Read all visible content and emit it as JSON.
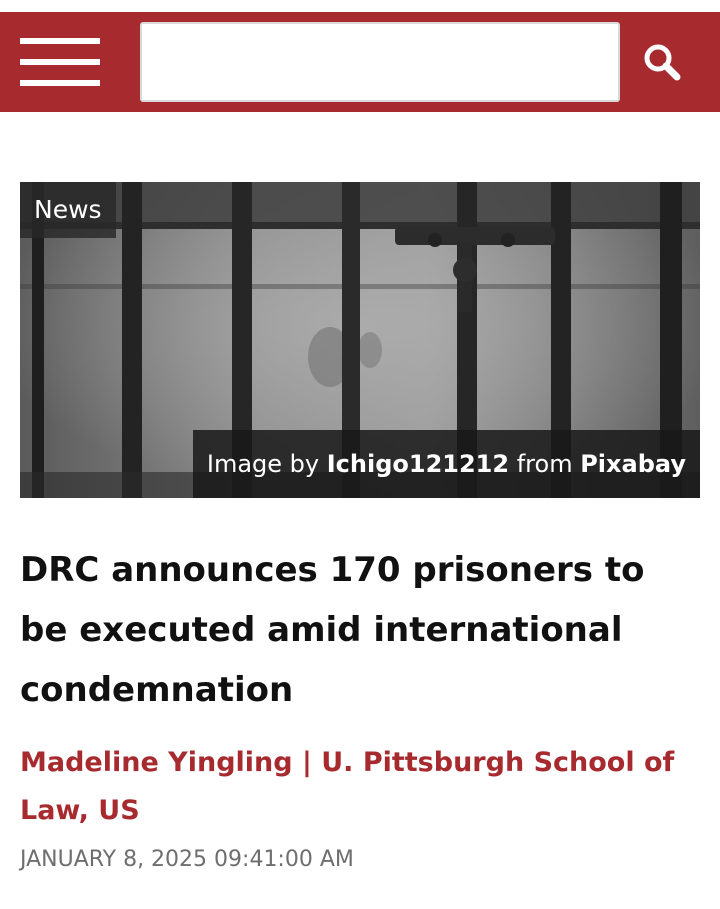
{
  "header": {
    "brand_color": "#a62a2e",
    "menu_icon": "hamburger-menu-icon",
    "search": {
      "value": "",
      "placeholder": ""
    },
    "search_icon": "search-icon"
  },
  "article": {
    "category": "News",
    "image": {
      "description_icon": "prison-bars-photo",
      "credit": {
        "prefix": "Image by",
        "author": "Ichigo121212",
        "middle": "from",
        "source": "Pixabay"
      }
    },
    "headline": "DRC announces 170 prisoners to be executed amid international condemnation",
    "byline": "Madeline Yingling | U. Pittsburgh School of Law, US",
    "date": "JANUARY 8, 2025 09:41:00 AM"
  }
}
